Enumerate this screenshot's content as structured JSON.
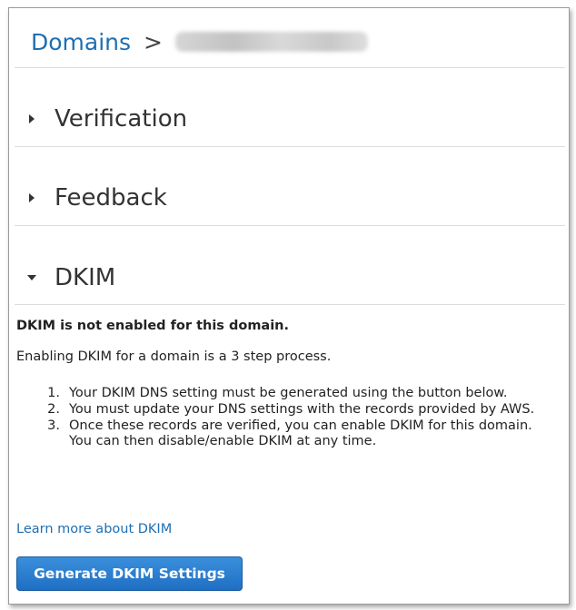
{
  "breadcrumb": {
    "root_label": "Domains",
    "separator": ">",
    "current_label": ""
  },
  "sections": [
    {
      "title": "Verification",
      "expanded": false,
      "icon": "caret-right-icon"
    },
    {
      "title": "Feedback",
      "expanded": false,
      "icon": "caret-right-icon"
    },
    {
      "title": "DKIM",
      "expanded": true,
      "icon": "caret-down-icon"
    }
  ],
  "dkim": {
    "status_text": "DKIM is not enabled for this domain.",
    "intro_text": "Enabling DKIM for a domain is a 3 step process.",
    "steps": [
      {
        "number": "1.",
        "text": "Your DKIM DNS setting must be generated using the button below."
      },
      {
        "number": "2.",
        "text": "You must update your DNS settings with the records provided by AWS."
      },
      {
        "number": "3.",
        "text": "Once these records are verified, you can enable DKIM for this domain. You can then disable/enable DKIM at any time."
      }
    ],
    "learn_more_label": "Learn more about DKIM",
    "generate_button_label": "Generate DKIM Settings"
  },
  "colors": {
    "link": "#1f6fb2",
    "button_top": "#3a8fdb",
    "button_bottom": "#1f6fc4"
  }
}
